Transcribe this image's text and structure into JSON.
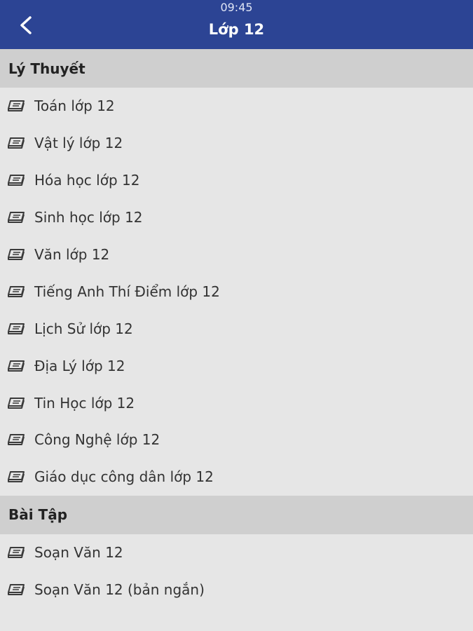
{
  "status_bar": {
    "time": "09:45"
  },
  "header": {
    "title": "Lớp 12",
    "back_icon": "chevron-left-icon",
    "background": "#2c4494"
  },
  "sections": [
    {
      "title": "Lý Thuyết",
      "items": [
        "Toán lớp 12",
        "Vật lý lớp 12",
        "Hóa học lớp 12",
        "Sinh học lớp 12",
        "Văn lớp 12",
        "Tiếng Anh Thí Điểm lớp 12",
        "Lịch Sử lớp 12",
        "Địa Lý lớp 12",
        "Tin Học lớp 12",
        "Công Nghệ lớp 12",
        "Giáo dục công dân lớp 12"
      ]
    },
    {
      "title": "Bài Tập",
      "items": [
        "Soạn Văn 12",
        "Soạn Văn 12 (bản ngắn)"
      ]
    }
  ],
  "item_icon": "book-icon"
}
